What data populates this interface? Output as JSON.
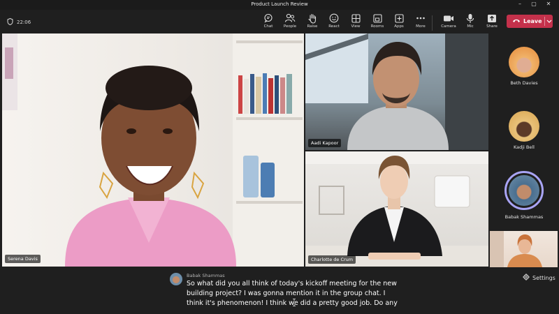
{
  "window": {
    "title": "Product Launch Review"
  },
  "meeting": {
    "elapsed": "22:06"
  },
  "toolbar": {
    "chat": "Chat",
    "people": "People",
    "raise": "Raise",
    "react": "React",
    "view": "View",
    "rooms": "Rooms",
    "apps": "Apps",
    "more": "More",
    "camera": "Camera",
    "mic": "Mic",
    "share": "Share",
    "leave": "Leave"
  },
  "participants": {
    "main": "Serena Davis",
    "top_right": "Aadi Kapoor",
    "bottom_right": "Charlotte de Crum"
  },
  "rail": [
    {
      "name": "Beth Davies"
    },
    {
      "name": "Kadji Bell"
    },
    {
      "name": "Babak Shammas"
    }
  ],
  "captions": {
    "speaker": "Babak Shammas",
    "lines": [
      "So what did you all think of today's kickoff meeting for the new",
      "building project? I was gonna mention it in the group chat. I",
      "think it's phenomenon! I think we did a pretty good job. Do any"
    ],
    "settings_label": "Settings"
  },
  "colors": {
    "leave": "#c4314b",
    "active_speaker_ring": "#a9a4f5",
    "background": "#1f1f1f"
  }
}
